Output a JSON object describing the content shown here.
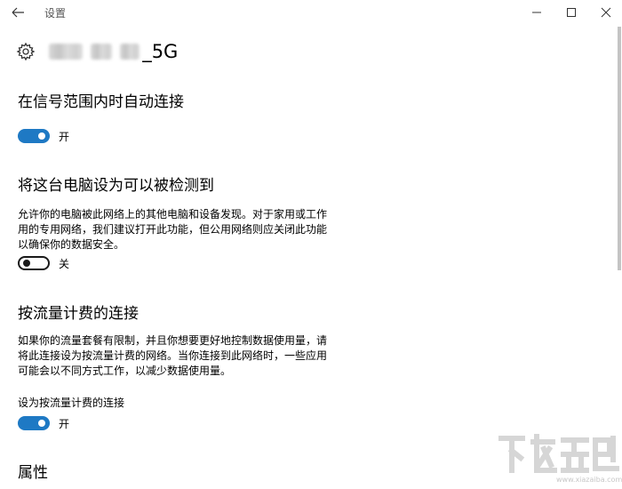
{
  "window": {
    "title": "设置",
    "icons": {
      "back": "arrow-left-icon",
      "minimize": "minimize-icon",
      "maximize": "maximize-icon",
      "close": "close-icon"
    }
  },
  "network": {
    "icon": "gear-icon",
    "name_suffix": "_5G"
  },
  "auto_connect": {
    "title": "在信号范围内时自动连接",
    "toggle_on": true,
    "state_label": "开"
  },
  "discoverable": {
    "title": "将这台电脑设为可以被检测到",
    "desc_lines": [
      "允许你的电脑被此网络上的其他电脑和设备发现。对于家用或工作",
      "用的专用网络，我们建议打开此功能，但公用网络则应关闭此功能",
      "以确保你的数据安全。"
    ],
    "toggle_on": false,
    "state_label": "关"
  },
  "metered": {
    "title": "按流量计费的连接",
    "desc_lines": [
      "如果你的流量套餐有限制，并且你想要更好地控制数据使用量，请",
      "将此连接设为按流量计费的网络。当你连接到此网络时，一些应用",
      "可能会以不同方式工作，以减少数据使用量。"
    ],
    "setting_label": "设为按流量计费的连接",
    "toggle_on": true,
    "state_label": "开"
  },
  "properties": {
    "title": "属性"
  },
  "colors": {
    "accent": "#1e79c4",
    "text": "#000000",
    "muted": "#555555"
  },
  "watermark": {
    "text": "www.xiazaiba.com"
  }
}
